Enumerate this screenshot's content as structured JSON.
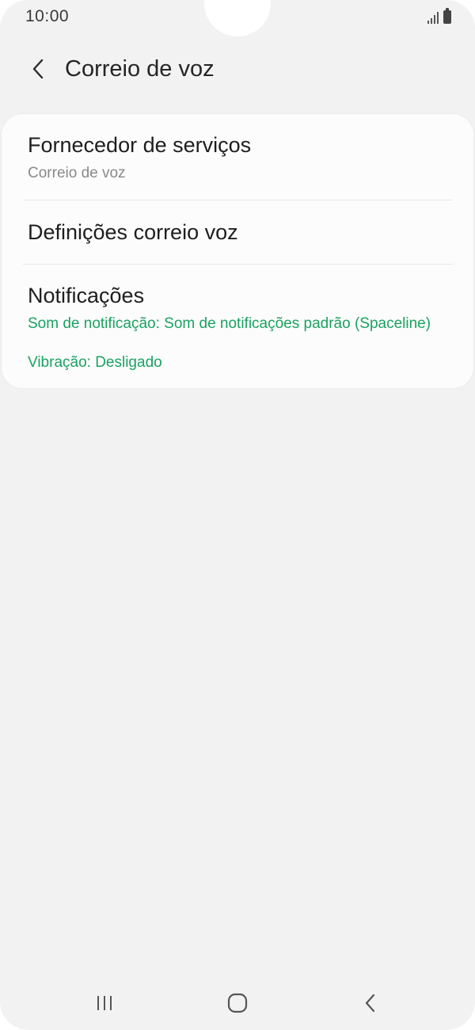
{
  "status_bar": {
    "time": "10:00",
    "icons": [
      "signal-icon",
      "battery-icon"
    ]
  },
  "header": {
    "back_icon": "chevron-left-icon",
    "title": "Correio de voz"
  },
  "settings": {
    "items": [
      {
        "title": "Fornecedor de serviços",
        "subtitle": "Correio de voz"
      },
      {
        "title": "Definições correio voz"
      },
      {
        "title": "Notificações",
        "details": [
          "Som de notificação: Som de notificações padrão (Spaceline)",
          "Vibração: Desligado"
        ]
      }
    ]
  },
  "colors": {
    "background": "#f2f2f2",
    "card": "#fcfcfc",
    "accent_green": "#1aa260",
    "title_text": "#252525",
    "subtitle_text": "#8a8a8a"
  },
  "nav_bar": {
    "icons": [
      "recent-apps-icon",
      "home-icon",
      "back-icon"
    ]
  }
}
